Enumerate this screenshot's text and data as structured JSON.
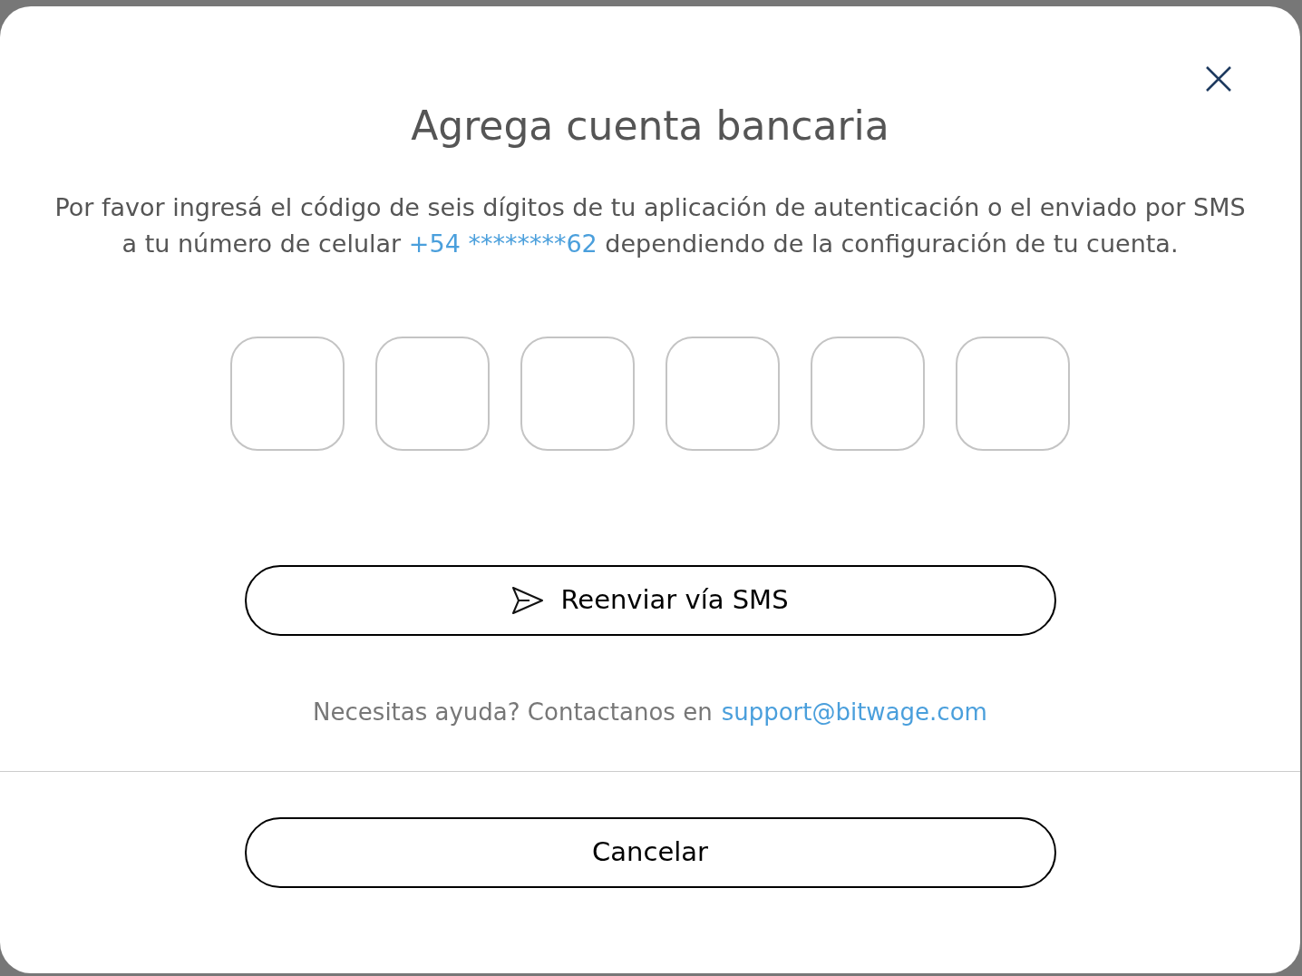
{
  "dialog": {
    "title": "Agrega cuenta bancaria",
    "message": {
      "before": "Por favor ingresá el código de seis dígitos de tu aplicación de autenticación o el enviado por SMS a tu número de celular",
      "phone": "+54 ********62",
      "after": "dependiendo de la configuración de tu cuenta."
    },
    "code_fields": [
      {
        "focused": false
      },
      {
        "focused": false
      },
      {
        "focused": false
      },
      {
        "focused": false
      },
      {
        "focused": false
      },
      {
        "focused": false
      }
    ],
    "resend_button": "Reenviar vía SMS",
    "help": {
      "text": "Necesitas ayuda? Contactanos en",
      "email": "support@bitwage.com"
    },
    "cancel_button": "Cancelar"
  }
}
